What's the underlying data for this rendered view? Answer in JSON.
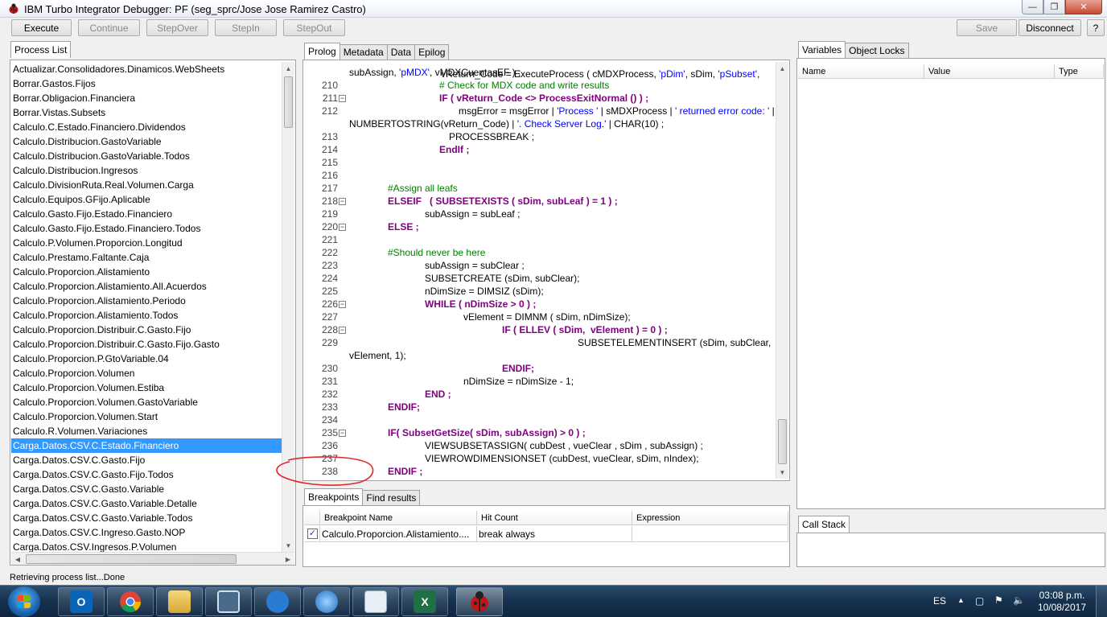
{
  "window": {
    "title": "IBM Turbo Integrator Debugger: PF (seg_sprc/Jose Jose Ramirez Castro)"
  },
  "toolbar": {
    "execute": "Execute",
    "continue": "Continue",
    "stepover": "StepOver",
    "stepin": "StepIn",
    "stepout": "StepOut",
    "save": "Save",
    "disconnect": "Disconnect",
    "help": "?"
  },
  "process_list": {
    "tab": "Process List",
    "items": [
      "Actualizar.Consolidadores.Dinamicos.WebSheets",
      "Borrar.Gastos.Fijos",
      "Borrar.Obligacion.Financiera",
      "Borrar.Vistas.Subsets",
      "Calculo.C.Estado.Financiero.Dividendos",
      "Calculo.Distribucion.GastoVariable",
      "Calculo.Distribucion.GastoVariable.Todos",
      "Calculo.Distribucion.Ingresos",
      "Calculo.DivisionRuta.Real.Volumen.Carga",
      "Calculo.Equipos.GFijo.Aplicable",
      "Calculo.Gasto.Fijo.Estado.Financiero",
      "Calculo.Gasto.Fijo.Estado.Financiero.Todos",
      "Calculo.P.Volumen.Proporcion.Longitud",
      "Calculo.Prestamo.Faltante.Caja",
      "Calculo.Proporcion.Alistamiento",
      "Calculo.Proporcion.Alistamiento.All.Acuerdos",
      "Calculo.Proporcion.Alistamiento.Periodo",
      "Calculo.Proporcion.Alistamiento.Todos",
      "Calculo.Proporcion.Distribuir.C.Gasto.Fijo",
      "Calculo.Proporcion.Distribuir.C.Gasto.Fijo.Gasto",
      "Calculo.Proporcion.P.GtoVariable.04",
      "Calculo.Proporcion.Volumen",
      "Calculo.Proporcion.Volumen.Estiba",
      "Calculo.Proporcion.Volumen.GastoVariable",
      "Calculo.Proporcion.Volumen.Start",
      "Calculo.R.Volumen.Variaciones",
      "Carga.Datos.CSV.C.Estado.Financiero",
      "Carga.Datos.CSV.C.Gasto.Fijo",
      "Carga.Datos.CSV.C.Gasto.Fijo.Todos",
      "Carga.Datos.CSV.C.Gasto.Variable",
      "Carga.Datos.CSV.C.Gasto.Variable.Detalle",
      "Carga.Datos.CSV.C.Gasto.Variable.Todos",
      "Carga.Datos.CSV.C.Ingreso.Gasto.NOP",
      "Carga.Datos.CSV.Ingresos.P.Volumen"
    ],
    "selected_index": 26
  },
  "editor": {
    "tabs": [
      "Prolog",
      "Metadata",
      "Data",
      "Epilog"
    ],
    "active_tab": "Prolog",
    "top_partial": "vReturn_Code = ExecuteProcess ( cMDXProcess, 'pDim', sDim, 'pSubset',",
    "lines": [
      {
        "n": "",
        "t": "subAssign, 'pMDX', vMDXCuentasEF ) ;"
      },
      {
        "n": "210",
        "t": "# Check for MDX code and write results"
      },
      {
        "n": "211",
        "t": "IF ( vReturn_Code <> ProcessExitNormal () ) ;"
      },
      {
        "n": "212",
        "t": "msgError = msgError | 'Process ' | sMDXProcess | ' returned error code: ' |"
      },
      {
        "n": "",
        "t": "NUMBERTOSTRING(vReturn_Code) | '. Check Server Log.' | CHAR(10) ;"
      },
      {
        "n": "213",
        "t": "PROCESSBREAK ;"
      },
      {
        "n": "214",
        "t": "EndIf ;"
      },
      {
        "n": "215",
        "t": ""
      },
      {
        "n": "216",
        "t": ""
      },
      {
        "n": "217",
        "t": "#Assign all leafs"
      },
      {
        "n": "218",
        "t": "ELSEIF   ( SUBSETEXISTS ( sDim, subLeaf ) = 1 ) ;"
      },
      {
        "n": "219",
        "t": "subAssign = subLeaf ;"
      },
      {
        "n": "220",
        "t": "ELSE ;"
      },
      {
        "n": "221",
        "t": ""
      },
      {
        "n": "222",
        "t": "#Should never be here"
      },
      {
        "n": "223",
        "t": "subAssign = subClear ;"
      },
      {
        "n": "224",
        "t": "SUBSETCREATE (sDim, subClear);"
      },
      {
        "n": "225",
        "t": "nDimSize = DIMSIZ (sDim);"
      },
      {
        "n": "226",
        "t": "WHILE ( nDimSize > 0 ) ;"
      },
      {
        "n": "227",
        "t": "vElement = DIMNM ( sDim, nDimSize);"
      },
      {
        "n": "228",
        "t": "IF ( ELLEV ( sDim,  vElement ) = 0 ) ;"
      },
      {
        "n": "229",
        "t": "SUBSETELEMENTINSERT (sDim, subClear,"
      },
      {
        "n": "",
        "t": "vElement, 1);"
      },
      {
        "n": "230",
        "t": "ENDIF;"
      },
      {
        "n": "231",
        "t": "nDimSize = nDimSize - 1;"
      },
      {
        "n": "232",
        "t": "END ;"
      },
      {
        "n": "233",
        "t": "ENDIF;"
      },
      {
        "n": "234",
        "t": ""
      },
      {
        "n": "235",
        "t": "IF( SubsetGetSize( sDim, subAssign) > 0 ) ;"
      },
      {
        "n": "236",
        "t": "VIEWSUBSETASSIGN( cubDest , vueClear , sDim , subAssign) ;"
      },
      {
        "n": "237",
        "t": "VIEWROWDIMENSIONSET (cubDest, vueClear, sDim, nIndex);"
      },
      {
        "n": "238",
        "t": "ENDIF ;"
      }
    ]
  },
  "breakpoints": {
    "tabs": [
      "Breakpoints",
      "Find results"
    ],
    "columns": [
      "Breakpoint Name",
      "Hit Count",
      "Expression"
    ],
    "rows": [
      {
        "checked": true,
        "name": "Calculo.Proporcion.Alistamiento....",
        "hit": "break always",
        "expr": ""
      }
    ]
  },
  "variables": {
    "tabs": [
      "Variables",
      "Object Locks"
    ],
    "columns": [
      "Name",
      "Value",
      "Type"
    ]
  },
  "callstack": {
    "tab": "Call Stack"
  },
  "status": "Retrieving process list...Done",
  "tray": {
    "lang": "ES",
    "time": "03:08 p.m.",
    "date": "10/08/2017"
  },
  "colors": {
    "keyword": "#800080",
    "comment": "#008000",
    "string": "#0000ff",
    "selection": "#3399ff",
    "annotation": "#e0282a"
  }
}
